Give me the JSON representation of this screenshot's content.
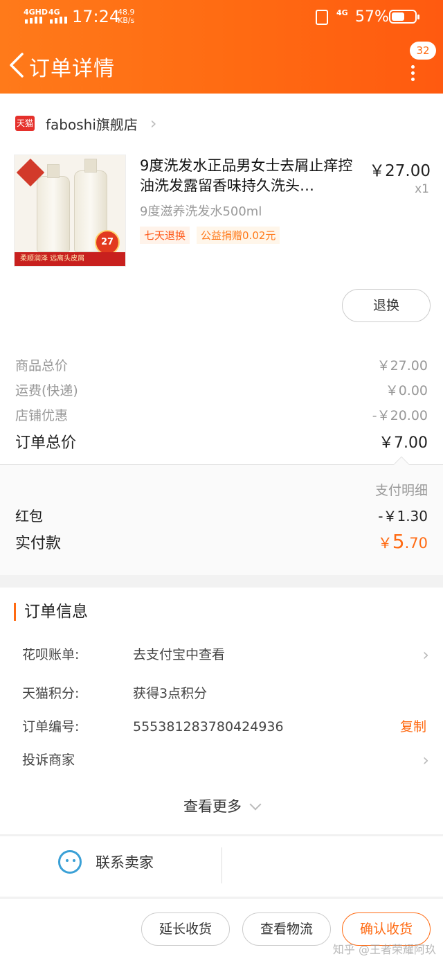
{
  "status_bar": {
    "signal1": "4GHD",
    "signal2": "4G",
    "time": "17:24",
    "speed_value": "48.9",
    "speed_unit": "KB/s",
    "network": "4G",
    "battery_percent": "57%",
    "battery_level": 0.57
  },
  "header": {
    "title": "订单详情",
    "badge_count": "32"
  },
  "store": {
    "platform_logo": "天猫",
    "name": "faboshi旗舰店"
  },
  "product": {
    "name": "9度洗发水正品男女士去屑止痒控油洗发露留香味持久洗头…",
    "spec": "9度滋养洗发水500ml",
    "price": "￥27.00",
    "quantity": "x1",
    "tags": [
      "七天退换",
      "公益捐赠0.02元"
    ],
    "thumb_text": {
      "banner": "柔顺润泽 远离头皮屑",
      "price_badge": "27"
    },
    "refund_button": "退换"
  },
  "summary": {
    "rows": [
      {
        "label": "商品总价",
        "value": "￥27.00"
      },
      {
        "label": "运费(快递)",
        "value": "￥0.00"
      },
      {
        "label": "店铺优惠",
        "value": "-￥20.00"
      }
    ],
    "total_label": "订单总价",
    "total_value": "￥7.00"
  },
  "payment": {
    "detail_link": "支付明细",
    "redpacket_label": "红包",
    "redpacket_value": "-￥1.30",
    "paid_label": "实付款",
    "paid_currency": "￥",
    "paid_int": "5",
    "paid_dec": ".70"
  },
  "order_info": {
    "title": "订单信息",
    "rows": [
      {
        "label": "花呗账单:",
        "value": "去支付宝中查看"
      },
      {
        "label": "天猫积分:",
        "value": "获得3点积分"
      },
      {
        "label": "订单编号:",
        "value": "5553812837804249​36",
        "action": "复制"
      },
      {
        "label": "投诉商家",
        "value": ""
      }
    ],
    "view_more": "查看更多"
  },
  "contact": {
    "label": "联系卖家"
  },
  "actions": {
    "extend": "延长收货",
    "logistics": "查看物流",
    "confirm": "确认收货"
  },
  "watermark": "知乎 @王者荣耀阿玖"
}
